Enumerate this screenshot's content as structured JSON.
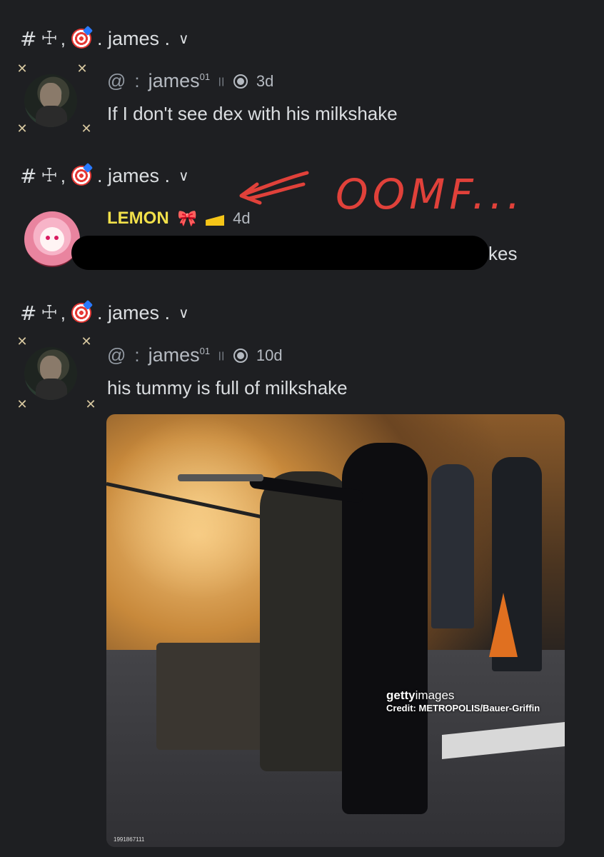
{
  "messages": [
    {
      "context": {
        "prefix": "#",
        "name": ". james .",
        "chevron": "∨"
      },
      "author": {
        "at": "@",
        "colon": ":",
        "username": "james",
        "sup": "01",
        "sep": "||",
        "timestamp": "3d"
      },
      "text": "If I don't see dex with his milkshake"
    },
    {
      "context": {
        "prefix": "#",
        "name": ". james .",
        "chevron": "∨"
      },
      "author": {
        "username": "LEMON",
        "timestamp": "4d"
      },
      "text_tail": "kes"
    },
    {
      "context": {
        "prefix": "#",
        "name": ". james .",
        "chevron": "∨"
      },
      "author": {
        "at": "@",
        "colon": ":",
        "username": "james",
        "sup": "01",
        "sep": "||",
        "timestamp": "10d"
      },
      "text": "his tummy is full of milkshake",
      "image": {
        "credit_brand_a": "getty",
        "credit_brand_b": "images",
        "credit_line": "Credit: METROPOLIS/Bauer-Griffin",
        "image_id": "1991867111"
      }
    }
  ],
  "annotation": {
    "text": "OOMF...",
    "arrow": "⇐"
  },
  "colors": {
    "background": "#1e1f22",
    "lemon": "#f1e04a",
    "annotation": "#e0413a"
  }
}
